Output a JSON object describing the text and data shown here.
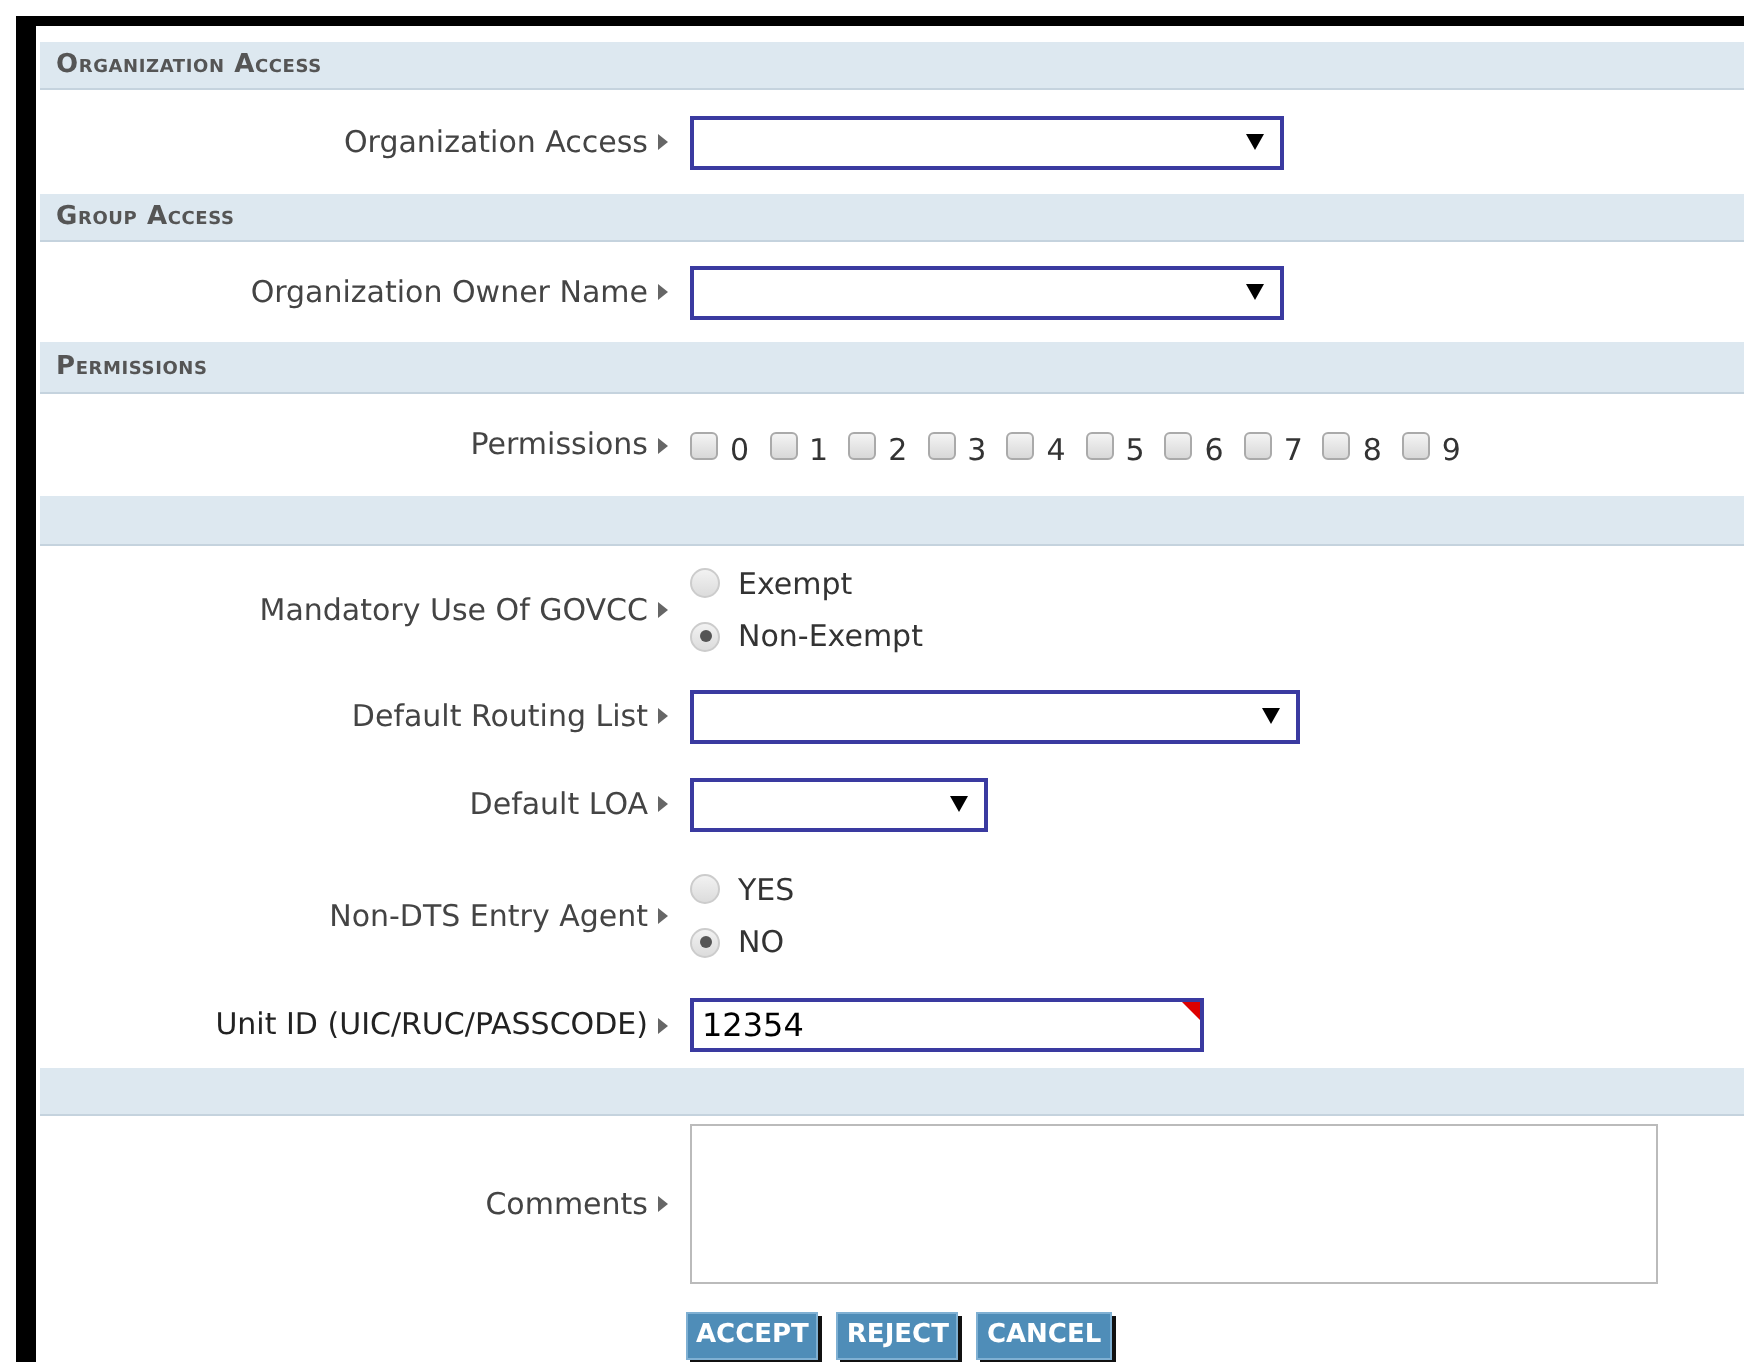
{
  "form": [
    {
      "kind": "heading",
      "text": "Organization Access"
    },
    {
      "kind": "select",
      "label": "Organization Access"
    },
    {
      "kind": "heading",
      "text": "Group Access"
    },
    {
      "kind": "select",
      "label": "Organization Owner Name"
    },
    {
      "kind": "heading",
      "text": "Permissions"
    },
    {
      "kind": "checkboxes",
      "label": "Permissions",
      "options": [
        {
          "label": "0",
          "checked": false
        },
        {
          "label": "1",
          "checked": false
        },
        {
          "label": "2",
          "checked": false
        },
        {
          "label": "3",
          "checked": false
        },
        {
          "label": "4",
          "checked": false
        },
        {
          "label": "5",
          "checked": false
        },
        {
          "label": "6",
          "checked": false
        },
        {
          "label": "7",
          "checked": false
        },
        {
          "label": "8",
          "checked": false
        },
        {
          "label": "9",
          "checked": false
        }
      ]
    },
    {
      "kind": "heading"
    },
    {
      "kind": "radios",
      "label": "Mandatory Use Of GOVCC",
      "options": [
        {
          "label": "Exempt",
          "selected": false
        },
        {
          "label": "Non-Exempt",
          "selected": true
        }
      ]
    },
    {
      "kind": "select",
      "label": "Default Routing List"
    },
    {
      "kind": "select",
      "label": "Default LOA"
    },
    {
      "kind": "radios",
      "label": "Non-DTS Entry Agent",
      "options": [
        {
          "label": "YES",
          "selected": false
        },
        {
          "label": "NO",
          "selected": true
        }
      ]
    },
    {
      "kind": "text",
      "label": "Unit ID (UIC/RUC/PASSCODE)",
      "value": "12354",
      "flagged": true
    },
    {
      "kind": "heading"
    },
    {
      "kind": "textarea",
      "label": "Comments"
    }
  ],
  "buttons": [
    "ACCEPT",
    "REJECT",
    "CANCEL"
  ]
}
